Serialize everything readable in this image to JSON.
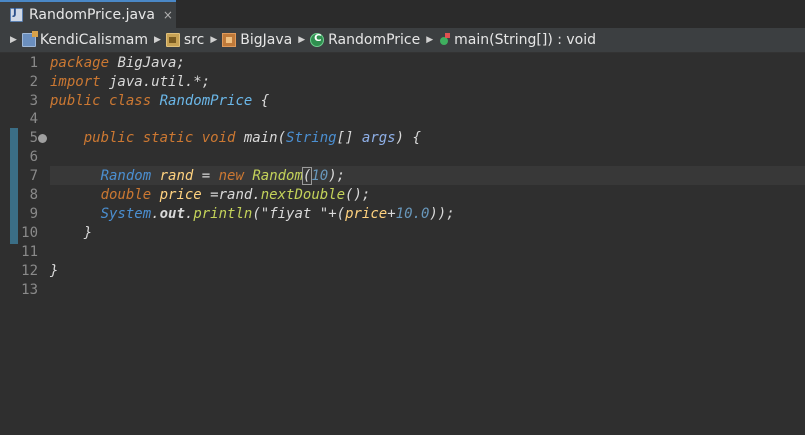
{
  "tab": {
    "title": "RandomPrice.java",
    "close": "×"
  },
  "breadcrumb": {
    "items": [
      {
        "label": "KendiCalismam",
        "icon": "project-icon"
      },
      {
        "label": "src",
        "icon": "source-folder-icon"
      },
      {
        "label": "BigJava",
        "icon": "package-icon"
      },
      {
        "label": "RandomPrice",
        "icon": "class-icon"
      },
      {
        "label": "main(String[]) : void",
        "icon": "method-icon"
      }
    ]
  },
  "editor": {
    "line_numbers": [
      "1",
      "2",
      "3",
      "4",
      "5",
      "6",
      "7",
      "8",
      "9",
      "10",
      "11",
      "12",
      "13"
    ],
    "fold_marker_line": "5",
    "current_line": "7",
    "code": {
      "l1_kw": "package",
      "l1_rest": " BigJava;",
      "l2_kw": "import",
      "l2_rest": " java.util.*;",
      "l3_kw": "public class",
      "l3_cls": "RandomPrice",
      "l3_rest": " {",
      "l5_kw1": "public static void",
      "l5_mth": " main(",
      "l5_ty": "String",
      "l5_brk": "[] ",
      "l5_par": "args",
      "l5_end": ") {",
      "l7_ty": "Random",
      "l7_var": " rand",
      "l7_eq": " = ",
      "l7_kw": "new",
      "l7_cls": " Random",
      "l7_open": "(",
      "l7_num": "10",
      "l7_end": ");",
      "l8_kw": "double",
      "l8_var": " price",
      "l8_eq": " =rand.",
      "l8_mth": "nextDouble",
      "l8_end": "();",
      "l9_ty": "System",
      "l9_dot": ".",
      "l9_fld": "out",
      "l9_dot2": ".",
      "l9_mth": "println",
      "l9_str": "(\"fiyat \"+(",
      "l9_var": "price",
      "l9_plus": "+",
      "l9_num": "10.0",
      "l9_end": "));",
      "l10": "}",
      "l12": "}"
    }
  }
}
